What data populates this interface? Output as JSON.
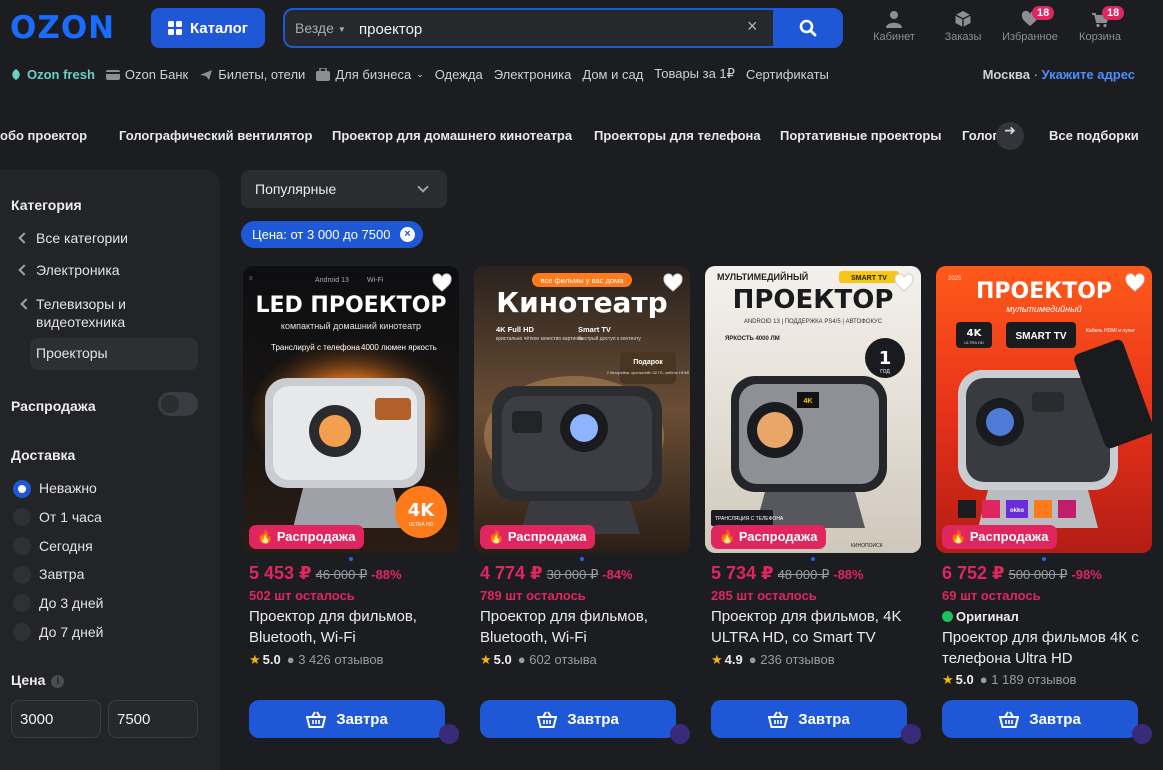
{
  "header": {
    "logo": "OZON",
    "catalog_label": "Каталог",
    "search": {
      "scope": "Везде",
      "query": "проектор"
    },
    "icons": [
      {
        "label": "Кабинет",
        "icon": "user-icon",
        "badge": ""
      },
      {
        "label": "Заказы",
        "icon": "box-icon",
        "badge": ""
      },
      {
        "label": "Избранное",
        "icon": "heart-icon",
        "badge": "18"
      },
      {
        "label": "Корзина",
        "icon": "cart-icon",
        "badge": "18"
      }
    ]
  },
  "nav": {
    "items": [
      "Ozon fresh",
      "Ozon Банк",
      "Билеты, отели",
      "Для бизнеса",
      "Одежда",
      "Электроника",
      "Дом и сад",
      "Товары за 1₽",
      "Сертификаты"
    ],
    "location_city": "Москва",
    "location_link": "Укажите адрес"
  },
  "chips": [
    "обо проектор",
    "Голографический вентилятор",
    "Проектор для домашнего кинотеатра",
    "Проекторы для телефона",
    "Портативные проекторы",
    "Голог",
    "Все подборки"
  ],
  "sidebar": {
    "category_title": "Категория",
    "categories": [
      "Все категории",
      "Электроника",
      "Телевизоры и видеотехника"
    ],
    "selected_category": "Проекторы",
    "sale_title": "Распродажа",
    "delivery_title": "Доставка",
    "delivery_options": [
      "Неважно",
      "От 1 часа",
      "Сегодня",
      "Завтра",
      "До 3 дней",
      "До 7 дней"
    ],
    "price_title": "Цена",
    "price_from": "3000",
    "price_to": "7500"
  },
  "sort_label": "Популярные",
  "active_filter": "Цена: от 3 000 до 7500",
  "colors": {
    "accent": "#1f58d6",
    "sale": "#e0265f",
    "bg": "#1c1d20"
  },
  "products": [
    {
      "image_texts": [
        "Android 13",
        "Wi-Fi",
        "LED ПРОЕКТОР",
        "компактный домашний кинотеатр",
        "Транслируй с телефона",
        "4000 люмен яркость",
        "4K",
        "ULTRA HD"
      ],
      "sale_label": "Распродажа",
      "price": "5 453 ₽",
      "old_price": "46 000 ₽",
      "discount": "-88%",
      "left": "502 шт осталось",
      "original": "",
      "title": "Проектор для фильмов, Bluetooth, Wi-Fi",
      "rating": "5.0",
      "reviews": "3 426 отзывов",
      "button": "Завтра"
    },
    {
      "image_texts": [
        "все фильмы у вас дома",
        "Кинотеатр",
        "4K Full HD",
        "кристально чёткое качество картинки",
        "Smart TV",
        "быстрый доступ к контенту",
        "Подарок",
        "2 батарейки, кронштейн 32 ГБ, кабель HDMI"
      ],
      "sale_label": "Распродажа",
      "price": "4 774 ₽",
      "old_price": "30 000 ₽",
      "discount": "-84%",
      "left": "789 шт осталось",
      "original": "",
      "title": "Проектор для фильмов, Bluetooth, Wi-Fi",
      "rating": "5.0",
      "reviews": "602 отзыва",
      "button": "Завтра"
    },
    {
      "image_texts": [
        "МУЛЬТИМЕДИЙНЫЙ",
        "SMART TV",
        "ПРОЕКТОР",
        "ANDROID 13 | ПОДДЕРЖКА PS4/5 | АВТОФОКУС",
        "ЯРКОСТЬ 4000 ЛМ",
        "1",
        "ГОД",
        "ТРАНСЛЯЦИЯ С ТЕЛЕФОНА",
        "4K",
        "КИНОПОИСК"
      ],
      "sale_label": "Распродажа",
      "price": "5 734 ₽",
      "old_price": "48 000 ₽",
      "discount": "-88%",
      "left": "285 шт осталось",
      "original": "",
      "title": "Проектор для фильмов, 4K ULTRA HD, со Smart TV",
      "rating": "4.9",
      "reviews": "236 отзывов",
      "button": "Завтра"
    },
    {
      "image_texts": [
        "2025",
        "ПРОЕКТОР",
        "мультимедийный",
        "4K",
        "ULTRA HD",
        "SMART TV",
        "Кабель HDMI и пульт",
        "okko"
      ],
      "sale_label": "Распродажа",
      "price": "6 752 ₽",
      "old_price": "500 000 ₽",
      "discount": "-98%",
      "left": "69 шт осталось",
      "original": "Оригинал",
      "title": "Проектор для фильмов 4К с телефона Ultra HD",
      "rating": "5.0",
      "reviews": "1 189 отзывов",
      "button": "Завтра"
    }
  ]
}
